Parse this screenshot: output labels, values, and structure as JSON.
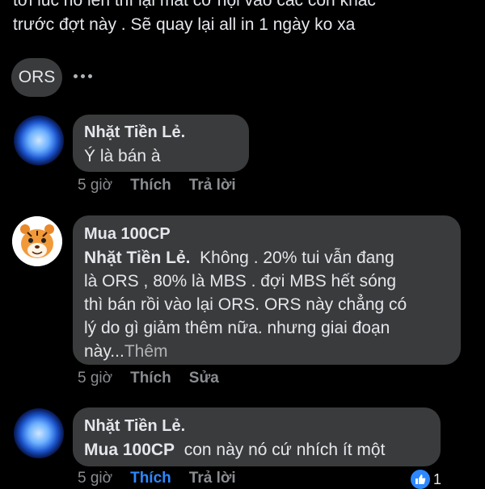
{
  "prev_comment": {
    "line1": "tới lúc nó lên thì lại mất cơ hội vào các con khác",
    "line2": "trước đợt này . Sẽ quay lại all in 1 ngày ko xa"
  },
  "chip": {
    "label": "ORS"
  },
  "comments": [
    {
      "author": "Nhặt Tiền Lẻ.",
      "text": "Ý là bán à",
      "time": "5 giờ",
      "like": "Thích",
      "reply": "Trả lời"
    },
    {
      "author": "Mua 100CP",
      "mention": "Nhặt Tiền Lẻ.",
      "line1": "Không . 20% tui vẫn đang",
      "line2": "là ORS , 80% là MBS . đợi MBS hết sóng",
      "line3": "thì bán rồi vào lại ORS. ORS này chẳng có",
      "line4": "lý do gì giảm thêm nữa. nhưng giai đoạn",
      "line5": "này...",
      "more": "Thêm",
      "time": "5 giờ",
      "like": "Thích",
      "edit": "Sửa"
    },
    {
      "author": "Nhặt Tiền Lẻ.",
      "mention": "Mua 100CP",
      "text": "con này nó cứ nhích ít một",
      "time": "5 giờ",
      "like": "Thích",
      "reply": "Trả lời",
      "reaction_count": "1"
    }
  ],
  "colors": {
    "background": "#000000",
    "bubble": "#3a3b3c",
    "text": "#e4e6eb",
    "muted": "#8a8d91",
    "accent": "#2d88ff"
  },
  "icons": [
    "more-dots-icon",
    "like-thumb-icon"
  ]
}
